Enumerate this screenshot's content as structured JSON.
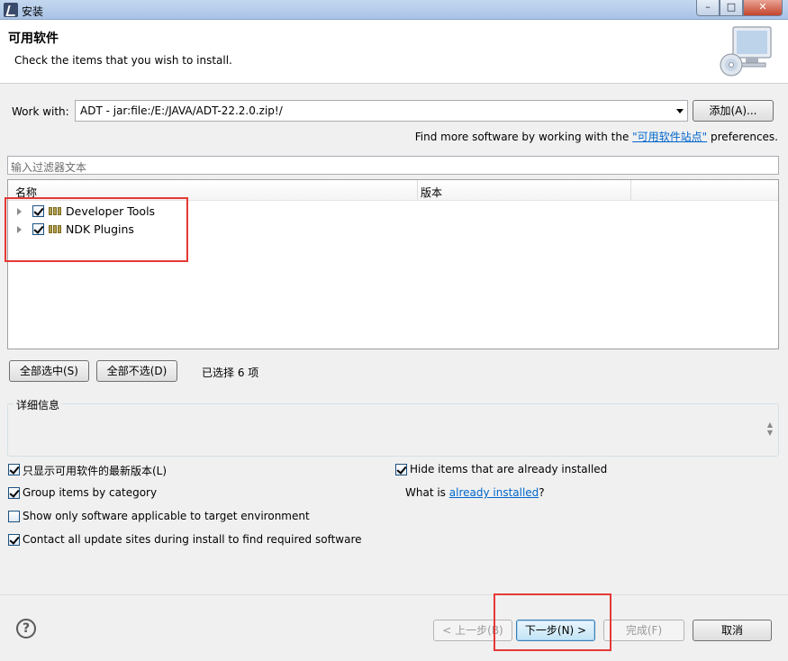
{
  "window": {
    "title": "安装",
    "buttons": {
      "minimize": "–",
      "maximize": "□",
      "close": "✕"
    }
  },
  "header": {
    "title": "可用软件",
    "description": "Check the items that you wish to install."
  },
  "workwith": {
    "label": "Work with:",
    "value": "ADT - jar:file:/E:/JAVA/ADT-22.2.0.zip!/",
    "add_button": "添加(A)..."
  },
  "findmore": {
    "prefix": "Find more software by working with the ",
    "link": "\"可用软件站点\"",
    "suffix": " preferences."
  },
  "filter": {
    "placeholder": "输入过滤器文本"
  },
  "tree": {
    "columns": [
      "名称",
      "版本"
    ],
    "items": [
      {
        "label": "Developer Tools",
        "checked": true
      },
      {
        "label": "NDK Plugins",
        "checked": true
      }
    ]
  },
  "selection": {
    "select_all": "全部选中(S)",
    "deselect_all": "全部不选(D)",
    "count_text": "已选择 6 项"
  },
  "details": {
    "legend": "详细信息"
  },
  "options": {
    "latest_only": {
      "label": "只显示可用软件的最新版本(L)",
      "checked": true
    },
    "group_by_category": {
      "label": "Group items by category",
      "checked": true
    },
    "target_env_only": {
      "label": "Show only software applicable to target environment",
      "checked": false
    },
    "contact_sites": {
      "label": "Contact all update sites during install to find required software",
      "checked": true
    },
    "hide_installed": {
      "label": "Hide items that are already installed",
      "checked": true
    }
  },
  "whatis": {
    "prefix": "What is ",
    "link": "already installed",
    "suffix": "?"
  },
  "footer": {
    "help": "?",
    "back": "< 上一步(B)",
    "next": "下一步(N) >",
    "finish": "完成(F)",
    "cancel": "取消"
  },
  "colors": {
    "highlight": "#e53935",
    "link": "#0066cc"
  }
}
